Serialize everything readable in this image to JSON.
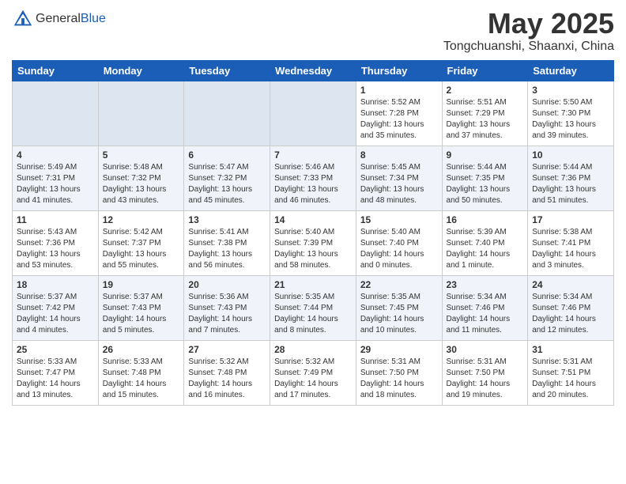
{
  "logo": {
    "general": "General",
    "blue": "Blue"
  },
  "title": "May 2025",
  "location": "Tongchuanshi, Shaanxi, China",
  "days_of_week": [
    "Sunday",
    "Monday",
    "Tuesday",
    "Wednesday",
    "Thursday",
    "Friday",
    "Saturday"
  ],
  "weeks": [
    [
      {
        "day": "",
        "info": ""
      },
      {
        "day": "",
        "info": ""
      },
      {
        "day": "",
        "info": ""
      },
      {
        "day": "",
        "info": ""
      },
      {
        "day": "1",
        "info": "Sunrise: 5:52 AM\nSunset: 7:28 PM\nDaylight: 13 hours and 35 minutes."
      },
      {
        "day": "2",
        "info": "Sunrise: 5:51 AM\nSunset: 7:29 PM\nDaylight: 13 hours and 37 minutes."
      },
      {
        "day": "3",
        "info": "Sunrise: 5:50 AM\nSunset: 7:30 PM\nDaylight: 13 hours and 39 minutes."
      }
    ],
    [
      {
        "day": "4",
        "info": "Sunrise: 5:49 AM\nSunset: 7:31 PM\nDaylight: 13 hours and 41 minutes."
      },
      {
        "day": "5",
        "info": "Sunrise: 5:48 AM\nSunset: 7:32 PM\nDaylight: 13 hours and 43 minutes."
      },
      {
        "day": "6",
        "info": "Sunrise: 5:47 AM\nSunset: 7:32 PM\nDaylight: 13 hours and 45 minutes."
      },
      {
        "day": "7",
        "info": "Sunrise: 5:46 AM\nSunset: 7:33 PM\nDaylight: 13 hours and 46 minutes."
      },
      {
        "day": "8",
        "info": "Sunrise: 5:45 AM\nSunset: 7:34 PM\nDaylight: 13 hours and 48 minutes."
      },
      {
        "day": "9",
        "info": "Sunrise: 5:44 AM\nSunset: 7:35 PM\nDaylight: 13 hours and 50 minutes."
      },
      {
        "day": "10",
        "info": "Sunrise: 5:44 AM\nSunset: 7:36 PM\nDaylight: 13 hours and 51 minutes."
      }
    ],
    [
      {
        "day": "11",
        "info": "Sunrise: 5:43 AM\nSunset: 7:36 PM\nDaylight: 13 hours and 53 minutes."
      },
      {
        "day": "12",
        "info": "Sunrise: 5:42 AM\nSunset: 7:37 PM\nDaylight: 13 hours and 55 minutes."
      },
      {
        "day": "13",
        "info": "Sunrise: 5:41 AM\nSunset: 7:38 PM\nDaylight: 13 hours and 56 minutes."
      },
      {
        "day": "14",
        "info": "Sunrise: 5:40 AM\nSunset: 7:39 PM\nDaylight: 13 hours and 58 minutes."
      },
      {
        "day": "15",
        "info": "Sunrise: 5:40 AM\nSunset: 7:40 PM\nDaylight: 14 hours and 0 minutes."
      },
      {
        "day": "16",
        "info": "Sunrise: 5:39 AM\nSunset: 7:40 PM\nDaylight: 14 hours and 1 minute."
      },
      {
        "day": "17",
        "info": "Sunrise: 5:38 AM\nSunset: 7:41 PM\nDaylight: 14 hours and 3 minutes."
      }
    ],
    [
      {
        "day": "18",
        "info": "Sunrise: 5:37 AM\nSunset: 7:42 PM\nDaylight: 14 hours and 4 minutes."
      },
      {
        "day": "19",
        "info": "Sunrise: 5:37 AM\nSunset: 7:43 PM\nDaylight: 14 hours and 5 minutes."
      },
      {
        "day": "20",
        "info": "Sunrise: 5:36 AM\nSunset: 7:43 PM\nDaylight: 14 hours and 7 minutes."
      },
      {
        "day": "21",
        "info": "Sunrise: 5:35 AM\nSunset: 7:44 PM\nDaylight: 14 hours and 8 minutes."
      },
      {
        "day": "22",
        "info": "Sunrise: 5:35 AM\nSunset: 7:45 PM\nDaylight: 14 hours and 10 minutes."
      },
      {
        "day": "23",
        "info": "Sunrise: 5:34 AM\nSunset: 7:46 PM\nDaylight: 14 hours and 11 minutes."
      },
      {
        "day": "24",
        "info": "Sunrise: 5:34 AM\nSunset: 7:46 PM\nDaylight: 14 hours and 12 minutes."
      }
    ],
    [
      {
        "day": "25",
        "info": "Sunrise: 5:33 AM\nSunset: 7:47 PM\nDaylight: 14 hours and 13 minutes."
      },
      {
        "day": "26",
        "info": "Sunrise: 5:33 AM\nSunset: 7:48 PM\nDaylight: 14 hours and 15 minutes."
      },
      {
        "day": "27",
        "info": "Sunrise: 5:32 AM\nSunset: 7:48 PM\nDaylight: 14 hours and 16 minutes."
      },
      {
        "day": "28",
        "info": "Sunrise: 5:32 AM\nSunset: 7:49 PM\nDaylight: 14 hours and 17 minutes."
      },
      {
        "day": "29",
        "info": "Sunrise: 5:31 AM\nSunset: 7:50 PM\nDaylight: 14 hours and 18 minutes."
      },
      {
        "day": "30",
        "info": "Sunrise: 5:31 AM\nSunset: 7:50 PM\nDaylight: 14 hours and 19 minutes."
      },
      {
        "day": "31",
        "info": "Sunrise: 5:31 AM\nSunset: 7:51 PM\nDaylight: 14 hours and 20 minutes."
      }
    ]
  ]
}
